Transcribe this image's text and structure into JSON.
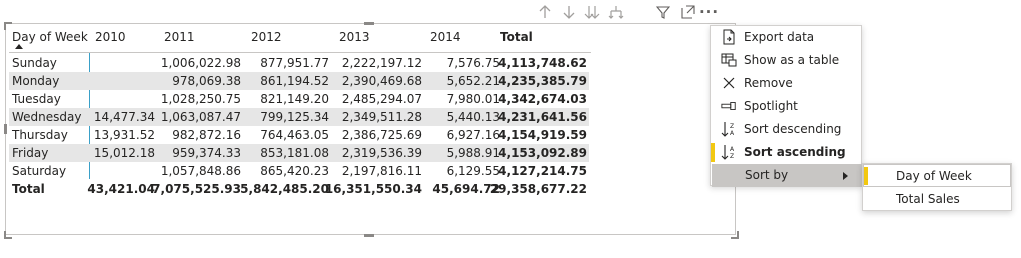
{
  "toolbar": {
    "icons": [
      "arrow-up-icon",
      "arrow-down-icon",
      "double-arrow-down-icon",
      "expand-hierarchy-icon",
      "filter-icon",
      "focus-mode-icon",
      "more-options-icon"
    ],
    "more_glyph": "···"
  },
  "table": {
    "columns": [
      "Day of Week",
      "2010",
      "2011",
      "2012",
      "2013",
      "2014",
      "Total"
    ],
    "rows": [
      {
        "label": "Sunday",
        "values": [
          "",
          "1,006,022.98",
          "877,951.77",
          "2,222,197.12",
          "7,576.75",
          "4,113,748.62"
        ]
      },
      {
        "label": "Monday",
        "values": [
          "",
          "978,069.38",
          "861,194.52",
          "2,390,469.68",
          "5,652.21",
          "4,235,385.79"
        ]
      },
      {
        "label": "Tuesday",
        "values": [
          "",
          "1,028,250.75",
          "821,149.20",
          "2,485,294.07",
          "7,980.01",
          "4,342,674.03"
        ]
      },
      {
        "label": "Wednesday",
        "values": [
          "14,477.34",
          "1,063,087.47",
          "799,125.34",
          "2,349,511.28",
          "5,440.13",
          "4,231,641.56"
        ]
      },
      {
        "label": "Thursday",
        "values": [
          "13,931.52",
          "982,872.16",
          "764,463.05",
          "2,386,725.69",
          "6,927.16",
          "4,154,919.59"
        ]
      },
      {
        "label": "Friday",
        "values": [
          "15,012.18",
          "959,374.33",
          "853,181.08",
          "2,319,536.39",
          "5,988.91",
          "4,153,092.89"
        ]
      },
      {
        "label": "Saturday",
        "values": [
          "",
          "1,057,848.86",
          "865,420.23",
          "2,197,816.11",
          "6,129.55",
          "4,127,214.75"
        ]
      }
    ],
    "total": {
      "label": "Total",
      "values": [
        "43,421.04",
        "7,075,525.93",
        "5,842,485.20",
        "16,351,550.34",
        "45,694.72",
        "29,358,677.22"
      ]
    }
  },
  "context_menu": {
    "items": [
      {
        "label": "Export data",
        "icon": "export-data-icon"
      },
      {
        "label": "Show as a table",
        "icon": "show-as-table-icon"
      },
      {
        "label": "Remove",
        "icon": "close-icon"
      },
      {
        "label": "Spotlight",
        "icon": "spotlight-icon"
      },
      {
        "label": "Sort descending",
        "icon": "sort-descending-icon"
      },
      {
        "label": "Sort ascending",
        "icon": "sort-ascending-icon",
        "selected": true
      },
      {
        "label": "Sort by",
        "icon": "chevron-right-icon"
      }
    ]
  },
  "sort_by_submenu": {
    "items": [
      {
        "label": "Day of Week",
        "selected": true
      },
      {
        "label": "Total Sales"
      }
    ]
  },
  "colors": {
    "accent": "#f2c811",
    "row_alt": "#e6e6e6",
    "divider": "#3aa0c8"
  }
}
